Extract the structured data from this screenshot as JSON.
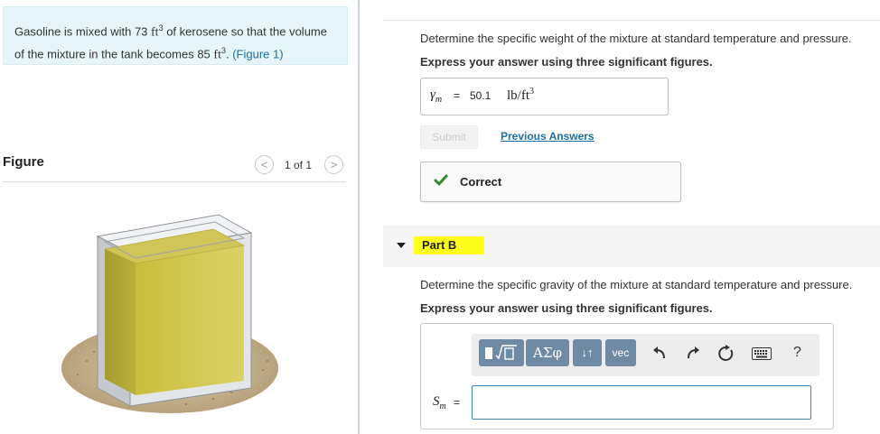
{
  "problem": {
    "text_before": "Gasoline is mixed with 73 ",
    "unit_1": "ft",
    "exp_1": "3",
    "text_middle": " of kerosene so that the volume of the mixture in the tank becomes 85 ",
    "unit_2": "ft",
    "exp_2": "3",
    "text_after": ". ",
    "figure_link": "(Figure 1)"
  },
  "figure": {
    "title": "Figure",
    "prev_glyph": "<",
    "next_glyph": ">",
    "page_indicator": "1 of 1",
    "image_icon": "tank-illustration"
  },
  "part_a": {
    "question": "Determine the specific weight of the mixture at standard temperature and pressure.",
    "instruction": "Express your answer using three significant figures.",
    "symbol": "γ",
    "symbol_sub": "m",
    "equals": "=",
    "value": "50.1",
    "unit": "lb/ft",
    "unit_exp": "3",
    "submit_label": "Submit",
    "previous_answers_label": "Previous Answers",
    "status_text": "Correct",
    "status_icon": "checkmark-icon"
  },
  "part_b": {
    "label": "Part B",
    "question": "Determine the specific gravity of the mixture at standard temperature and pressure.",
    "instruction": "Express your answer using three significant figures.",
    "symbol": "S",
    "symbol_sub": "m",
    "equals": "=",
    "input_value": "",
    "toolbar": {
      "templates_icon": "templates-icon",
      "greek_label": "ΑΣφ",
      "subscript_label": "↓↑",
      "vec_label": "vec",
      "undo_icon": "undo-icon",
      "redo_icon": "redo-icon",
      "reset_icon": "reset-icon",
      "keyboard_icon": "keyboard-icon",
      "help_label": "?"
    }
  },
  "colors": {
    "link": "#1a6fa3",
    "highlight": "#ffff1a",
    "problem_bg": "#e6f5f7",
    "correct_check": "#2e8b2e",
    "toolbar_button": "#6f8aa3",
    "input_border": "#3e86b9"
  }
}
